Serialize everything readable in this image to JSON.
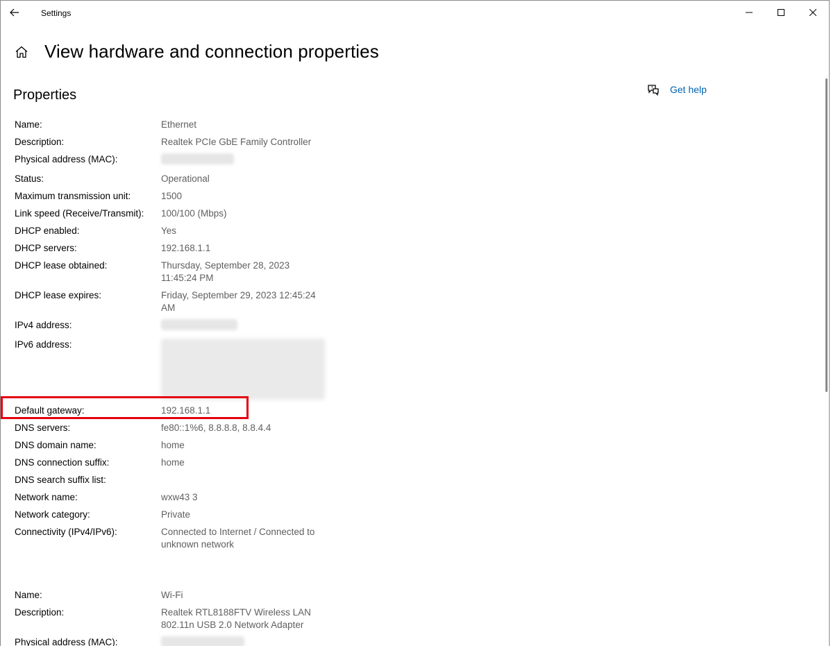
{
  "titlebar": {
    "app_title": "Settings"
  },
  "header": {
    "page_title": "View hardware and connection properties"
  },
  "section": {
    "title": "Properties"
  },
  "help": {
    "label": "Get help"
  },
  "ethernet": {
    "name_label": "Name:",
    "name": "Ethernet",
    "description_label": "Description:",
    "description": "Realtek PCIe GbE Family Controller",
    "mac_label": "Physical address (MAC):",
    "status_label": "Status:",
    "status": "Operational",
    "mtu_label": "Maximum transmission unit:",
    "mtu": "1500",
    "link_speed_label": "Link speed (Receive/Transmit):",
    "link_speed": "100/100 (Mbps)",
    "dhcp_enabled_label": "DHCP enabled:",
    "dhcp_enabled": "Yes",
    "dhcp_servers_label": "DHCP servers:",
    "dhcp_servers": "192.168.1.1",
    "lease_obtained_label": "DHCP lease obtained:",
    "lease_obtained": "Thursday, September 28, 2023 11:45:24 PM",
    "lease_expires_label": "DHCP lease expires:",
    "lease_expires": "Friday, September 29, 2023 12:45:24 AM",
    "ipv4_label": "IPv4 address:",
    "ipv6_label": "IPv6 address:",
    "gateway_label": "Default gateway:",
    "gateway": "192.168.1.1",
    "dns_servers_label": "DNS servers:",
    "dns_servers": "fe80::1%6, 8.8.8.8, 8.8.4.4",
    "dns_domain_label": "DNS domain name:",
    "dns_domain": "home",
    "dns_suffix_label": "DNS connection suffix:",
    "dns_suffix": "home",
    "dns_search_label": "DNS search suffix list:",
    "dns_search": "",
    "network_name_label": "Network name:",
    "network_name": "wxw43 3",
    "network_category_label": "Network category:",
    "network_category": "Private",
    "connectivity_label": "Connectivity (IPv4/IPv6):",
    "connectivity": "Connected to Internet / Connected to unknown network"
  },
  "wifi": {
    "name_label": "Name:",
    "name": "Wi-Fi",
    "description_label": "Description:",
    "description": "Realtek RTL8188FTV Wireless LAN 802.11n USB 2.0 Network Adapter",
    "mac_label": "Physical address (MAC):"
  },
  "colors": {
    "link": "#0063b1",
    "highlight": "#e4000f",
    "value_text": "#5f5f5f"
  }
}
